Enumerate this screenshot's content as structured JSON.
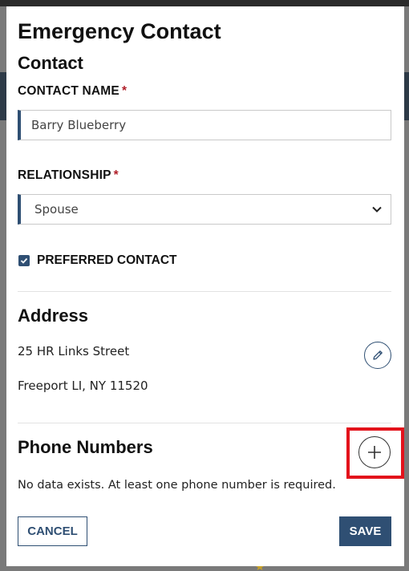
{
  "dialog": {
    "title": "Emergency Contact"
  },
  "contact_section": {
    "title": "Contact",
    "name_label": "CONTACT NAME",
    "name_value": "Barry Blueberry",
    "relationship_label": "RELATIONSHIP",
    "relationship_value": "Spouse",
    "required_marker": "*",
    "preferred_label": "PREFERRED CONTACT",
    "preferred_checked": true
  },
  "address_section": {
    "title": "Address",
    "line1": "25 HR Links Street",
    "line2": "Freeport LI, NY 11520",
    "edit_icon": "pencil-icon"
  },
  "phone_section": {
    "title": "Phone Numbers",
    "add_icon": "plus-icon",
    "empty_message": "No data exists. At least one phone number is required."
  },
  "actions": {
    "cancel_label": "CANCEL",
    "save_label": "SAVE"
  },
  "colors": {
    "accent": "#2f4f73",
    "required": "#b0202a",
    "highlight": "#e3121b"
  }
}
